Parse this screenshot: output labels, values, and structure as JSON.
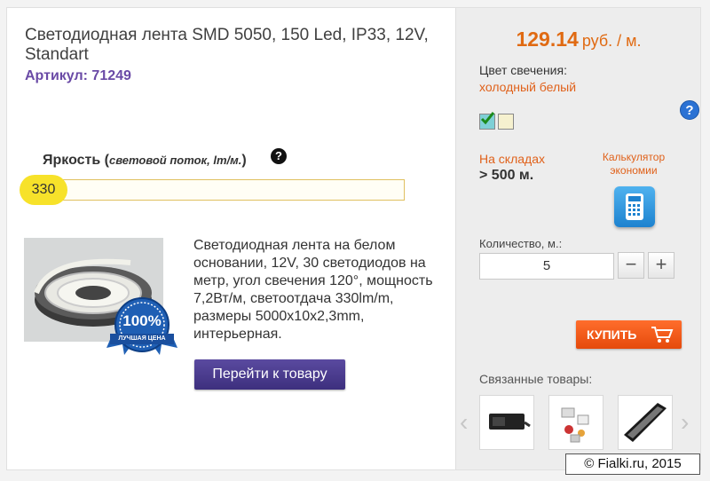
{
  "product": {
    "title": "Светодиодная лента SMD 5050, 150 Led, IP33, 12V, Standart",
    "sku_label": "Артикул: 71249"
  },
  "brightness": {
    "label_main": "Яркость (",
    "label_italic": "световой поток, lm/м.",
    "label_close": ")",
    "value": "330",
    "help": "?",
    "level_fraction": 0.0
  },
  "description": "Светодиодная лента на белом основании, 12V, 30 светодиодов на метр, угол свечения 120°, мощность 7,2Вт/м, светоотдача 330lm/m, размеры 5000x10x2,3mm, интерьерная.",
  "badge": {
    "percent": "100%",
    "text": "ЛУЧШАЯ ЦЕНА"
  },
  "goto_button": "Перейти к товару",
  "price": {
    "amount": "129.14",
    "unit": "руб. / м."
  },
  "color": {
    "label": "Цвет свечения:",
    "value": "холодный белый",
    "help": "?",
    "swatches": [
      {
        "color": "#7fd0d6",
        "selected": true
      },
      {
        "color": "#f6f1cf",
        "selected": false
      }
    ]
  },
  "stock": {
    "label": "На складах",
    "value": "> 500 м."
  },
  "calculator": {
    "label": "Калькулятор экономии",
    "icon": "calculator-icon"
  },
  "quantity": {
    "label": "Количество, м.:",
    "value": "5",
    "minus": "−",
    "plus": "+"
  },
  "buy_button": "КУПИТЬ",
  "related": {
    "label": "Связанные товары:",
    "prev": "‹",
    "next": "›"
  },
  "copyright": "© Fialki.ru, 2015",
  "colors": {
    "accent": "#e06a12",
    "brand_purple": "#6a4aa6",
    "buy": "#f0561a",
    "help_blue": "#2b72d4"
  }
}
